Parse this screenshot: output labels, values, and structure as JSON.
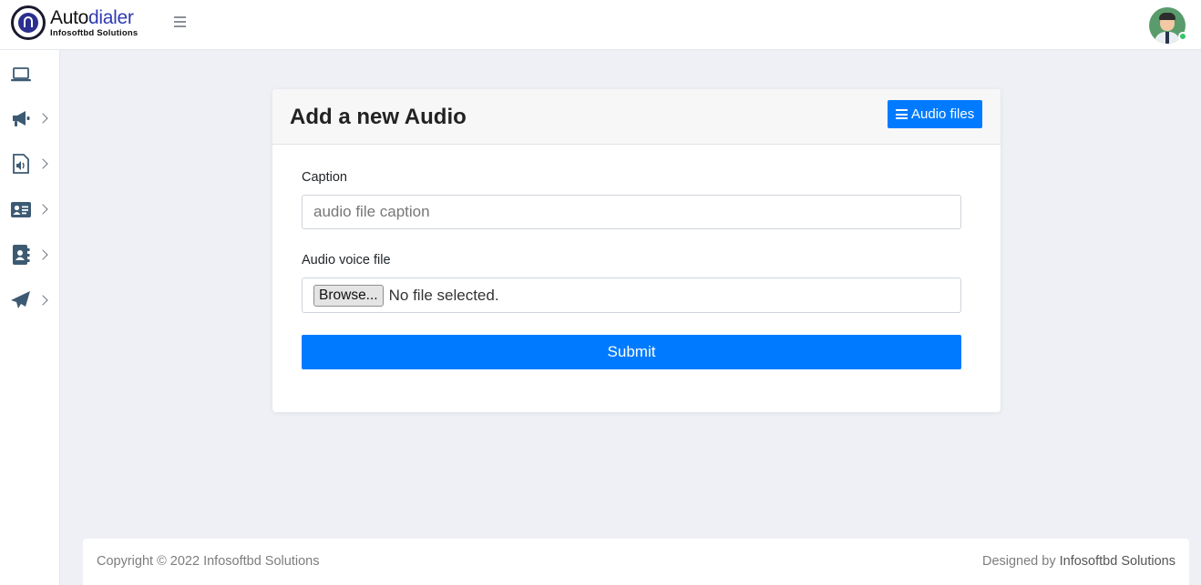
{
  "brand": {
    "name_part1": "Auto",
    "name_part2": "dialer",
    "subtitle": "Infosoftbd Solutions",
    "accent_color": "#2f3bb3"
  },
  "header": {
    "menu_icon": "hamburger-icon",
    "avatar_icon": "user-avatar",
    "status": "online"
  },
  "sidebar": {
    "items": [
      {
        "icon": "laptop-icon",
        "has_submenu": false
      },
      {
        "icon": "megaphone-icon",
        "has_submenu": true
      },
      {
        "icon": "audio-file-icon",
        "has_submenu": true
      },
      {
        "icon": "contact-card-icon",
        "has_submenu": true
      },
      {
        "icon": "address-book-icon",
        "has_submenu": true
      },
      {
        "icon": "paper-plane-icon",
        "has_submenu": true
      }
    ]
  },
  "card": {
    "title": "Add a new Audio",
    "audio_files_button": "Audio files",
    "audio_files_icon": "list-icon"
  },
  "form": {
    "caption_label": "Caption",
    "caption_placeholder": "audio file caption",
    "caption_value": "",
    "file_label": "Audio voice file",
    "browse_label": "Browse...",
    "file_status": "No file selected.",
    "submit_label": "Submit"
  },
  "footer": {
    "copyright": "Copyright © 2022 Infosoftbd Solutions",
    "designed_prefix": "Designed by",
    "designed_link": "Infosoftbd Solutions"
  },
  "colors": {
    "primary": "#007bff",
    "page_background": "#eef0f5",
    "sidebar_icon": "#3d5a73"
  }
}
